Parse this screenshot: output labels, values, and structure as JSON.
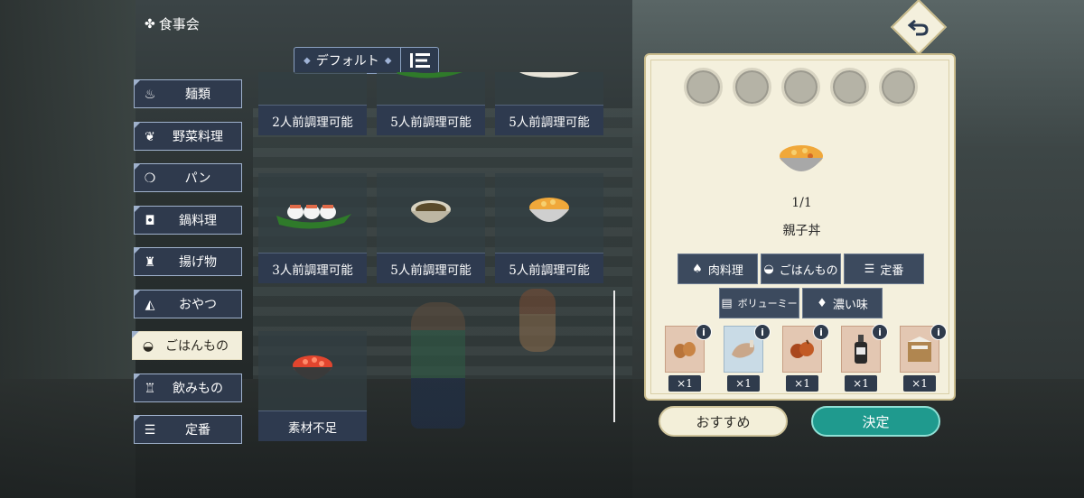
{
  "header": {
    "title": "食事会",
    "deco": "✤"
  },
  "sort": {
    "label": "デフォルト"
  },
  "categories": [
    {
      "label": "麺類",
      "icon": "noodle-icon",
      "glyph": "♨"
    },
    {
      "label": "野菜料理",
      "icon": "vegetable-icon",
      "glyph": "❦"
    },
    {
      "label": "パン",
      "icon": "bread-icon",
      "glyph": "❍"
    },
    {
      "label": "鍋料理",
      "icon": "pot-icon",
      "glyph": "◘"
    },
    {
      "label": "揚げ物",
      "icon": "fries-icon",
      "glyph": "♜"
    },
    {
      "label": "おやつ",
      "icon": "cake-icon",
      "glyph": "◭"
    },
    {
      "label": "ごはんもの",
      "icon": "rice-bowl-icon",
      "glyph": "◒"
    },
    {
      "label": "飲みもの",
      "icon": "drink-icon",
      "glyph": "♖"
    },
    {
      "label": "定番",
      "icon": "burger-icon",
      "glyph": "☰"
    }
  ],
  "recipes": [
    {
      "caption": "2人前調理可能",
      "dish": "salmon-bowl"
    },
    {
      "caption": "5人前調理可能",
      "dish": "rice-balls"
    },
    {
      "caption": "5人前調理可能",
      "dish": "omurice"
    },
    {
      "caption": "3人前調理可能",
      "dish": "sushi-plate"
    },
    {
      "caption": "5人前調理可能",
      "dish": "stew-bowl"
    },
    {
      "caption": "5人前調理可能",
      "dish": "oyakodon"
    },
    {
      "caption": "素材不足",
      "dish": "ikura-bowl"
    }
  ],
  "detail": {
    "count": "1/1",
    "name": "親子丼",
    "tags": [
      {
        "label": "肉料理",
        "icon": "meat-icon",
        "glyph": "♠"
      },
      {
        "label": "ごはんもの",
        "icon": "rice-bowl-icon",
        "glyph": "◒"
      },
      {
        "label": "定番",
        "icon": "burger-icon",
        "glyph": "☰"
      },
      {
        "label": "ボリューミー",
        "icon": "volume-icon",
        "glyph": "▤"
      },
      {
        "label": "濃い味",
        "icon": "sauce-icon",
        "glyph": "♦"
      }
    ],
    "ingredients": [
      {
        "name": "egg",
        "qty": "×1",
        "info": "i"
      },
      {
        "name": "chicken",
        "qty": "×1",
        "info": "i"
      },
      {
        "name": "onion",
        "qty": "×1",
        "info": "i"
      },
      {
        "name": "soy-sauce",
        "qty": "×1",
        "info": "i"
      },
      {
        "name": "rice",
        "qty": "×1",
        "info": "i"
      }
    ]
  },
  "buttons": {
    "recommend": "おすすめ",
    "confirm": "決定"
  },
  "colors": {
    "panel": "#f4f0dd",
    "tab": "#2f3a4d",
    "confirm": "#1f9a8e"
  }
}
